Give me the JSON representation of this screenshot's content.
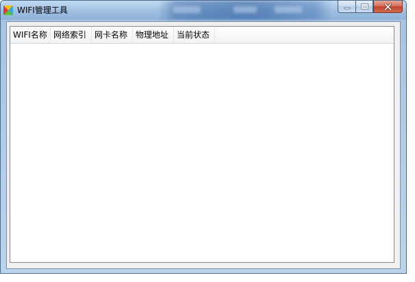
{
  "window": {
    "title": "WIFI管理工具",
    "icon": "app-logo-icon"
  },
  "caption_buttons": {
    "minimize_icon": "minimize-icon",
    "maximize_icon": "maximize-icon",
    "close_icon": "close-icon"
  },
  "listview": {
    "columns": [
      {
        "label": "WIFI名称"
      },
      {
        "label": "网络索引"
      },
      {
        "label": "网卡名称"
      },
      {
        "label": "物理地址"
      },
      {
        "label": "当前状态"
      }
    ],
    "rows": []
  },
  "colors": {
    "titlebar": "#a9c4e2",
    "close_button": "#c2462e",
    "client_background": "#f0f0f0",
    "list_background": "#ffffff"
  }
}
